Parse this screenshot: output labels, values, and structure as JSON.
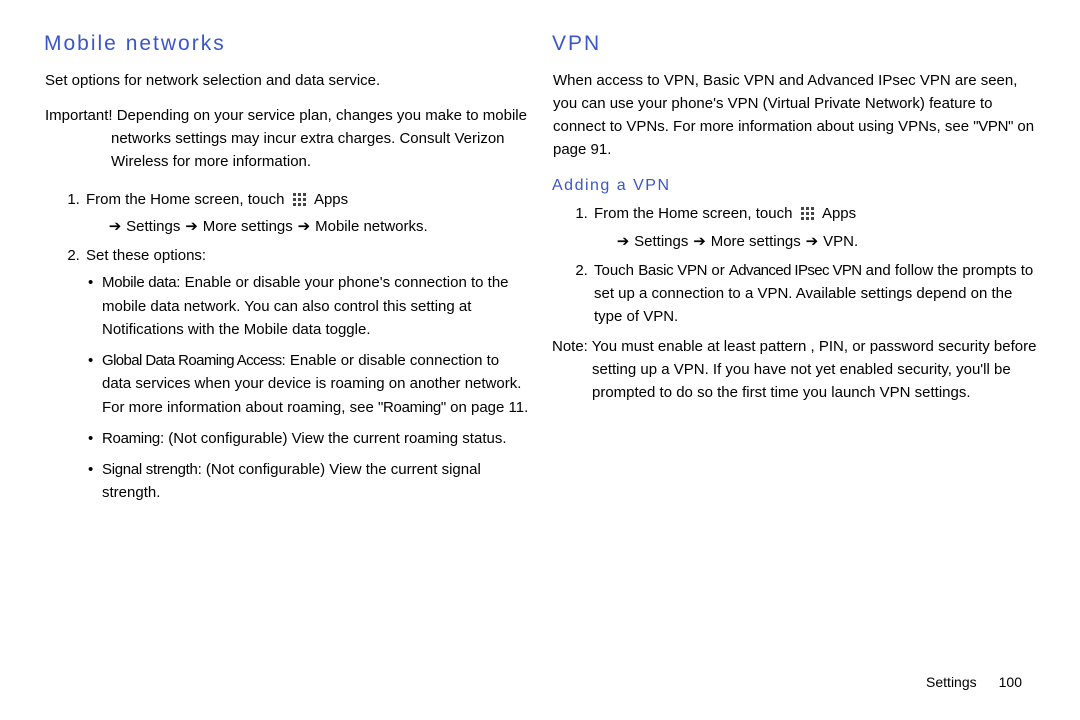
{
  "left": {
    "heading": "Mobile networks",
    "intro": "Set options for network selection and data service.",
    "important_label": "Important!",
    "important_body": "Depending on your service plan, changes you make to mobile networks settings may incur extra charges. Consult Verizon Wireless for more information.",
    "step1_a": "From the Home screen, touch",
    "step1_b": "Apps",
    "path_sep": "➔",
    "path1": "Settings",
    "path2": "More settings",
    "path3": "Mobile networks.",
    "step2": "Set these options:",
    "b1_label": "Mobile data",
    "b1_body": ": Enable or disable your phone's connection to the mobile data network. You can also control this setting at Notifications with the Mobile data toggle.",
    "b2_label": "Global Data Roaming Access",
    "b2_body_a": ": Enable or disable connection to data services when your device is roaming on another network. For more information about roaming, see ",
    "b2_ref": "\"Roaming\"",
    "b2_body_b": " on page 11.",
    "b3_label": "Roaming",
    "b3_body": ": (Not configurable) View the current roaming status.",
    "b4_label": "Signal strength",
    "b4_body": ": (Not configurable) View the current signal strength."
  },
  "right": {
    "heading": "VPN",
    "intro_a": "When access to VPN, Basic VPN and Advanced IPsec VPN are seen, you can use your phone's VPN (Virtual Private Network) feature to connect to VPNs.  For more information about using VPNs, see ",
    "intro_ref": "\"VPN\"",
    "intro_b": " on page 91.",
    "sub": "Adding a VPN",
    "s1_a": "From the Home screen, touch",
    "s1_b": "Apps",
    "path1": "Settings",
    "path2": "More settings",
    "path3": "VPN.",
    "s2_a": "Touch ",
    "s2_b1": "Basic VPN",
    "s2_mid": " or ",
    "s2_b2": "Advanced IPsec VPN",
    "s2_c": " and follow the prompts to set up a connection to a VPN. Available settings depend on the type of VPN.",
    "note_label": "Note:",
    "note_body": "You must enable at least pattern , PIN, or password security before setting up a VPN. If you have not yet enabled security, you'll be prompted to do so the first time you launch VPN settings."
  },
  "footer": {
    "section": "Settings",
    "page": "100"
  }
}
